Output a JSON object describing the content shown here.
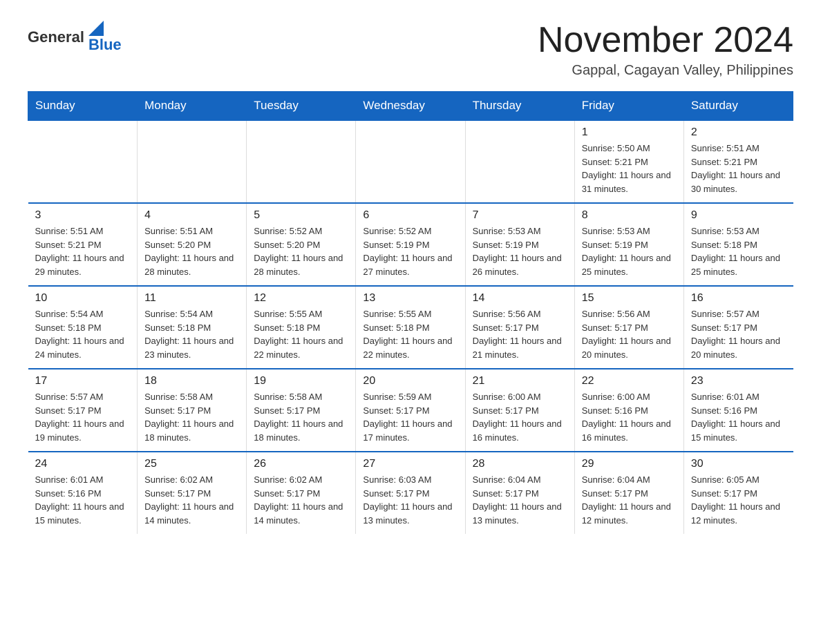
{
  "header": {
    "logo_general": "General",
    "logo_blue": "Blue",
    "title": "November 2024",
    "subtitle": "Gappal, Cagayan Valley, Philippines"
  },
  "weekdays": [
    "Sunday",
    "Monday",
    "Tuesday",
    "Wednesday",
    "Thursday",
    "Friday",
    "Saturday"
  ],
  "weeks": [
    [
      {
        "day": "",
        "detail": ""
      },
      {
        "day": "",
        "detail": ""
      },
      {
        "day": "",
        "detail": ""
      },
      {
        "day": "",
        "detail": ""
      },
      {
        "day": "",
        "detail": ""
      },
      {
        "day": "1",
        "detail": "Sunrise: 5:50 AM\nSunset: 5:21 PM\nDaylight: 11 hours and 31 minutes."
      },
      {
        "day": "2",
        "detail": "Sunrise: 5:51 AM\nSunset: 5:21 PM\nDaylight: 11 hours and 30 minutes."
      }
    ],
    [
      {
        "day": "3",
        "detail": "Sunrise: 5:51 AM\nSunset: 5:21 PM\nDaylight: 11 hours and 29 minutes."
      },
      {
        "day": "4",
        "detail": "Sunrise: 5:51 AM\nSunset: 5:20 PM\nDaylight: 11 hours and 28 minutes."
      },
      {
        "day": "5",
        "detail": "Sunrise: 5:52 AM\nSunset: 5:20 PM\nDaylight: 11 hours and 28 minutes."
      },
      {
        "day": "6",
        "detail": "Sunrise: 5:52 AM\nSunset: 5:19 PM\nDaylight: 11 hours and 27 minutes."
      },
      {
        "day": "7",
        "detail": "Sunrise: 5:53 AM\nSunset: 5:19 PM\nDaylight: 11 hours and 26 minutes."
      },
      {
        "day": "8",
        "detail": "Sunrise: 5:53 AM\nSunset: 5:19 PM\nDaylight: 11 hours and 25 minutes."
      },
      {
        "day": "9",
        "detail": "Sunrise: 5:53 AM\nSunset: 5:18 PM\nDaylight: 11 hours and 25 minutes."
      }
    ],
    [
      {
        "day": "10",
        "detail": "Sunrise: 5:54 AM\nSunset: 5:18 PM\nDaylight: 11 hours and 24 minutes."
      },
      {
        "day": "11",
        "detail": "Sunrise: 5:54 AM\nSunset: 5:18 PM\nDaylight: 11 hours and 23 minutes."
      },
      {
        "day": "12",
        "detail": "Sunrise: 5:55 AM\nSunset: 5:18 PM\nDaylight: 11 hours and 22 minutes."
      },
      {
        "day": "13",
        "detail": "Sunrise: 5:55 AM\nSunset: 5:18 PM\nDaylight: 11 hours and 22 minutes."
      },
      {
        "day": "14",
        "detail": "Sunrise: 5:56 AM\nSunset: 5:17 PM\nDaylight: 11 hours and 21 minutes."
      },
      {
        "day": "15",
        "detail": "Sunrise: 5:56 AM\nSunset: 5:17 PM\nDaylight: 11 hours and 20 minutes."
      },
      {
        "day": "16",
        "detail": "Sunrise: 5:57 AM\nSunset: 5:17 PM\nDaylight: 11 hours and 20 minutes."
      }
    ],
    [
      {
        "day": "17",
        "detail": "Sunrise: 5:57 AM\nSunset: 5:17 PM\nDaylight: 11 hours and 19 minutes."
      },
      {
        "day": "18",
        "detail": "Sunrise: 5:58 AM\nSunset: 5:17 PM\nDaylight: 11 hours and 18 minutes."
      },
      {
        "day": "19",
        "detail": "Sunrise: 5:58 AM\nSunset: 5:17 PM\nDaylight: 11 hours and 18 minutes."
      },
      {
        "day": "20",
        "detail": "Sunrise: 5:59 AM\nSunset: 5:17 PM\nDaylight: 11 hours and 17 minutes."
      },
      {
        "day": "21",
        "detail": "Sunrise: 6:00 AM\nSunset: 5:17 PM\nDaylight: 11 hours and 16 minutes."
      },
      {
        "day": "22",
        "detail": "Sunrise: 6:00 AM\nSunset: 5:16 PM\nDaylight: 11 hours and 16 minutes."
      },
      {
        "day": "23",
        "detail": "Sunrise: 6:01 AM\nSunset: 5:16 PM\nDaylight: 11 hours and 15 minutes."
      }
    ],
    [
      {
        "day": "24",
        "detail": "Sunrise: 6:01 AM\nSunset: 5:16 PM\nDaylight: 11 hours and 15 minutes."
      },
      {
        "day": "25",
        "detail": "Sunrise: 6:02 AM\nSunset: 5:17 PM\nDaylight: 11 hours and 14 minutes."
      },
      {
        "day": "26",
        "detail": "Sunrise: 6:02 AM\nSunset: 5:17 PM\nDaylight: 11 hours and 14 minutes."
      },
      {
        "day": "27",
        "detail": "Sunrise: 6:03 AM\nSunset: 5:17 PM\nDaylight: 11 hours and 13 minutes."
      },
      {
        "day": "28",
        "detail": "Sunrise: 6:04 AM\nSunset: 5:17 PM\nDaylight: 11 hours and 13 minutes."
      },
      {
        "day": "29",
        "detail": "Sunrise: 6:04 AM\nSunset: 5:17 PM\nDaylight: 11 hours and 12 minutes."
      },
      {
        "day": "30",
        "detail": "Sunrise: 6:05 AM\nSunset: 5:17 PM\nDaylight: 11 hours and 12 minutes."
      }
    ]
  ]
}
